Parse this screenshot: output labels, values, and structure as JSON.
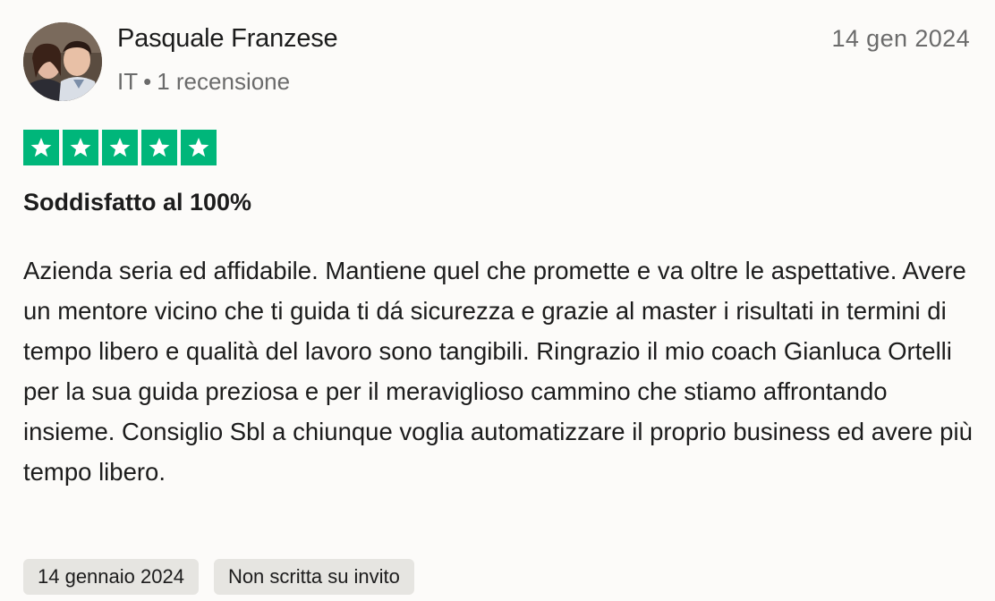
{
  "reviewer": {
    "name": "Pasquale Franzese",
    "country": "IT",
    "separator": "•",
    "review_count": "1 recensione",
    "avatar_icon": "profile-photo"
  },
  "review": {
    "date": "14 gen 2024",
    "rating": 5,
    "rating_max": 5,
    "star_color": "#00b67a",
    "title": "Soddisfatto al 100%",
    "body": "Azienda seria ed affidabile. Mantiene quel che promette e va oltre le aspettative. Avere un mentore vicino che ti guida ti dá sicurezza e grazie al master i risultati in termini di tempo libero e qualità del lavoro sono tangibili. Ringrazio il mio coach Gianluca Ortelli per la sua guida preziosa e per il meraviglioso cammino che stiamo affrontando insieme. Consiglio Sbl a chiunque voglia automatizzare il proprio business ed avere più tempo libero."
  },
  "tags": [
    {
      "label": "14 gennaio 2024"
    },
    {
      "label": "Non scritta su invito"
    }
  ]
}
